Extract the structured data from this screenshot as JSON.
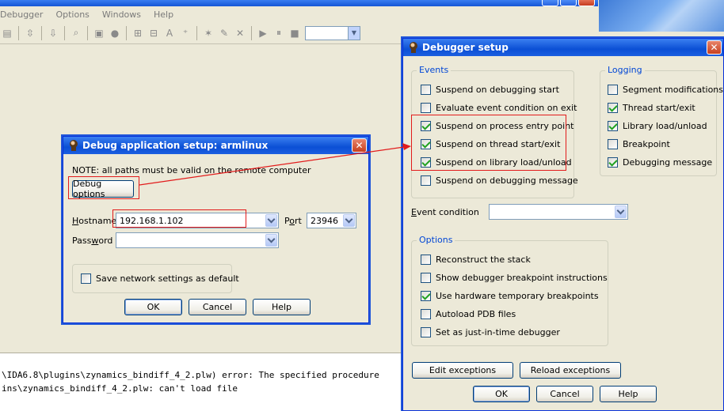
{
  "main_window": {
    "menu": [
      "Debugger",
      "Options",
      "Windows",
      "Help"
    ]
  },
  "output": {
    "lines": [
      "\\IDA6.8\\plugins\\zynamics_bindiff_4_2.plw) error: The specified procedure",
      "ins\\zynamics_bindiff_4_2.plw: can't load file"
    ]
  },
  "debug_app_dialog": {
    "title": "Debug application setup: armlinux",
    "note": "NOTE: all paths must be valid on the remote computer",
    "debug_options_label": "Debug options",
    "hostname_label": "Hostname",
    "hostname_value": "192.168.1.102",
    "port_label": "Port",
    "port_value": "23946",
    "password_label": "Password",
    "password_value": "",
    "save_settings_label": "Save network settings as default",
    "save_settings_checked": false,
    "ok_label": "OK",
    "cancel_label": "Cancel",
    "help_label": "Help"
  },
  "debugger_setup_dialog": {
    "title": "Debugger setup",
    "events": {
      "label": "Events",
      "items": [
        {
          "label": "Suspend on debugging start",
          "checked": false
        },
        {
          "label": "Evaluate event condition on exit",
          "checked": false
        },
        {
          "label": "Suspend on process entry point",
          "checked": true
        },
        {
          "label": "Suspend on thread start/exit",
          "checked": true
        },
        {
          "label": "Suspend on library load/unload",
          "checked": true
        },
        {
          "label": "Suspend on debugging message",
          "checked": false
        }
      ]
    },
    "logging": {
      "label": "Logging",
      "items": [
        {
          "label": "Segment modifications",
          "checked": false
        },
        {
          "label": "Thread start/exit",
          "checked": true
        },
        {
          "label": "Library load/unload",
          "checked": true
        },
        {
          "label": "Breakpoint",
          "checked": false
        },
        {
          "label": "Debugging message",
          "checked": true
        }
      ]
    },
    "event_condition_label": "Event condition",
    "event_condition_value": "",
    "options": {
      "label": "Options",
      "items": [
        {
          "label": "Reconstruct the stack",
          "checked": false
        },
        {
          "label": "Show debugger breakpoint instructions",
          "checked": false
        },
        {
          "label": "Use hardware temporary breakpoints",
          "checked": true
        },
        {
          "label": "Autoload PDB files",
          "checked": false
        },
        {
          "label": "Set as just-in-time debugger",
          "checked": false
        }
      ]
    },
    "edit_exceptions_label": "Edit exceptions",
    "reload_exceptions_label": "Reload exceptions",
    "ok_label": "OK",
    "cancel_label": "Cancel",
    "help_label": "Help"
  },
  "colors": {
    "annotation_red": "#e21b1b",
    "xp_title_blue": "#0b4fd5",
    "group_label_blue": "#0046d5"
  }
}
